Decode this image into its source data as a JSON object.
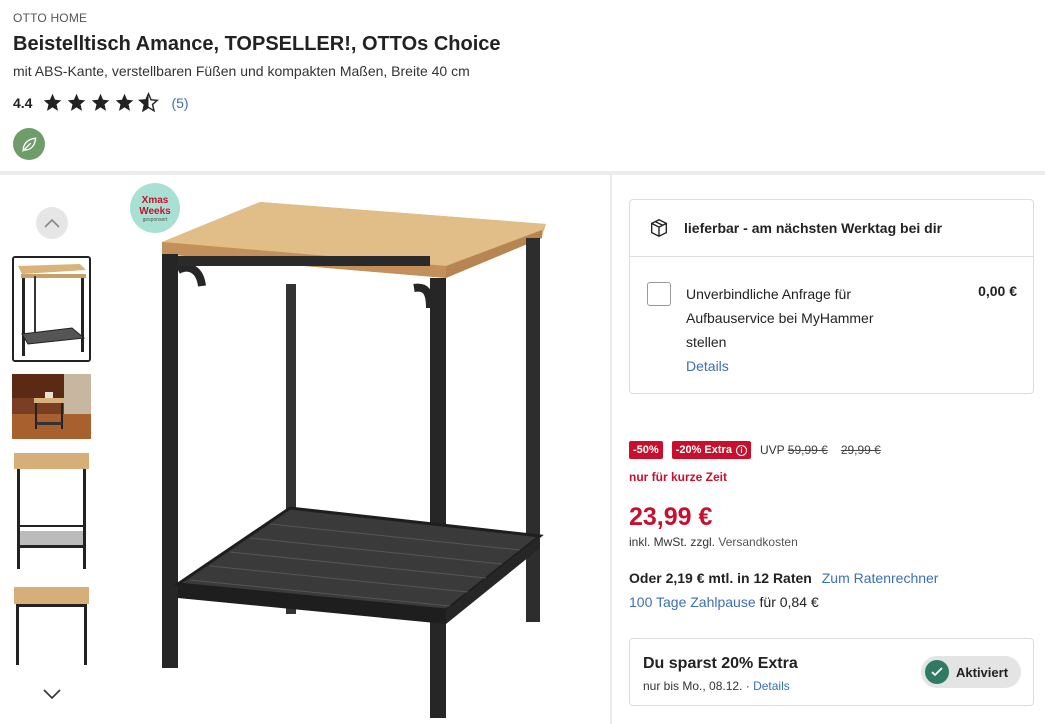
{
  "product": {
    "brand": "OTTO HOME",
    "title": "Beistelltisch Amance, TOPSELLER!, OTTOs Choice",
    "subtitle": "mit ABS-Kante, verstellbaren Füßen und kompakten Maßen, Breite 40 cm",
    "rating_value": "4.4",
    "rating_stars": 4.4,
    "rating_count": "(5)",
    "eco_icon": "leaf-icon"
  },
  "gallery": {
    "badge_line1": "Xmas",
    "badge_line2": "Weeks",
    "badge_line3": "gesponsert",
    "up_icon": "chevron-up-icon",
    "down_icon": "chevron-down-icon"
  },
  "delivery": {
    "icon": "package-icon",
    "status": "lieferbar - am nächsten Werktag bei dir",
    "service_text": "Unverbindliche Anfrage für Aufbauservice bei MyHammer stellen",
    "service_price": "0,00 €",
    "details": "Details"
  },
  "pricing": {
    "discount_badge": "-50%",
    "extra_badge": "-20% Extra",
    "info_glyph": "i",
    "uvp_label": "UVP",
    "uvp_price": "59,99 €",
    "old_price": "29,99 €",
    "short_time": "nur für kurze Zeit",
    "price": "23,99 €",
    "tax_prefix": "inkl. MwSt. zzgl.",
    "tax_shipping": "Versandkosten",
    "installment_text": "Oder 2,19 € mtl. in 12 Raten",
    "installment_link": "Zum Ratenrechner",
    "pause_link": "100 Tage Zahlpause",
    "pause_suffix": "für 0,84 €"
  },
  "savings": {
    "title": "Du sparst 20% Extra",
    "subtitle": "nur bis Mo., 08.12.",
    "separator": "·",
    "details": "Details",
    "status": "Aktiviert"
  },
  "colors": {
    "accent_red": "#c8102e",
    "link_blue": "#3b6fb6",
    "eco_green": "#6f9d6a",
    "check_green": "#2f7a63"
  }
}
